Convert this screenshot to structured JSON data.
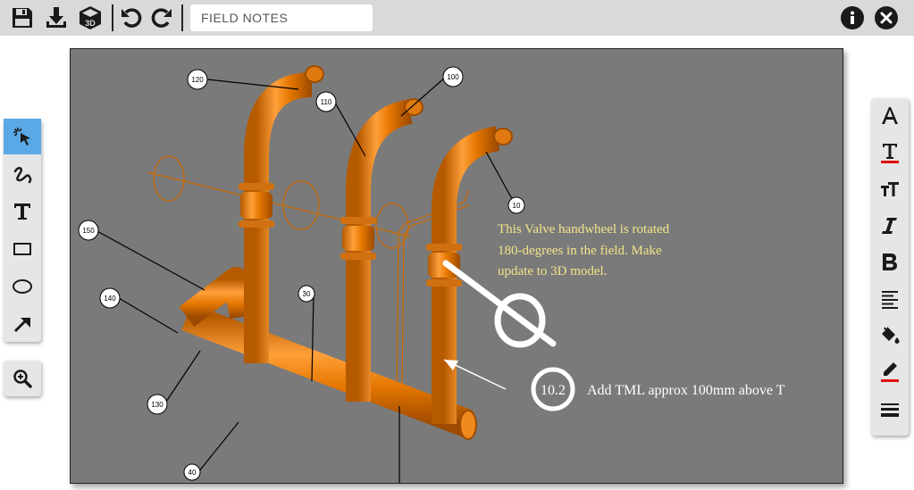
{
  "toolbar": {
    "save": "save",
    "download": "download",
    "model": "3D",
    "undo": "undo",
    "redo": "redo",
    "title_value": "FIELD NOTES",
    "info": "info",
    "close": "close"
  },
  "left_tools": [
    "select",
    "freehand",
    "text",
    "rectangle",
    "ellipse",
    "arrow"
  ],
  "zoom_tool": "zoom",
  "right_tools": [
    "font",
    "text-color",
    "font-size",
    "italic",
    "bold",
    "align",
    "fill-color",
    "stroke-color",
    "line-weight"
  ],
  "canvas": {
    "tags": [
      "120",
      "100",
      "110",
      "10",
      "150",
      "140",
      "30",
      "130",
      "40"
    ],
    "note1_lines": [
      "This Valve handwheel is rotated",
      "180-degrees in the field.  Make",
      "update to 3D model."
    ],
    "note2_tag": "10.2",
    "note2_text": "Add TML approx 100mm above T"
  },
  "colors": {
    "topbar": "#d9d9d9",
    "canvas_bg": "#7a7a7a",
    "pipe": "#e07a10",
    "note1_text": "#f3e58a",
    "active_tool": "#5aa9e6"
  }
}
